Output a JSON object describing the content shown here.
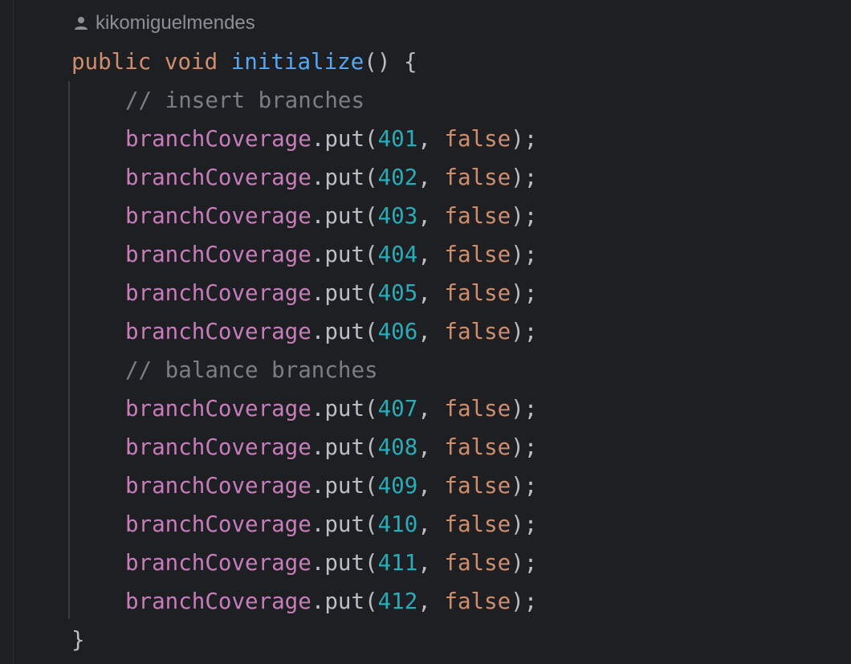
{
  "author": {
    "name": "kikomiguelmendes",
    "icon": "person-icon"
  },
  "method": {
    "modifier": "public",
    "return_type": "void",
    "name": "initialize",
    "params_open": "() {"
  },
  "comments": {
    "insert": "// insert branches",
    "balance": "// balance branches"
  },
  "call": {
    "object": "branchCoverage",
    "method": ".put(",
    "separator": ", ",
    "value": "false",
    "close": ");"
  },
  "insert_ids": [
    "401",
    "402",
    "403",
    "404",
    "405",
    "406"
  ],
  "balance_ids": [
    "407",
    "408",
    "409",
    "410",
    "411",
    "412"
  ],
  "closing_brace": "}",
  "colors": {
    "background": "#1e1f22",
    "keyword": "#cf8e6d",
    "function": "#56a8f5",
    "field": "#c77dbb",
    "number": "#2aacb8",
    "comment": "#7a7e85",
    "text": "#bcbec4"
  }
}
